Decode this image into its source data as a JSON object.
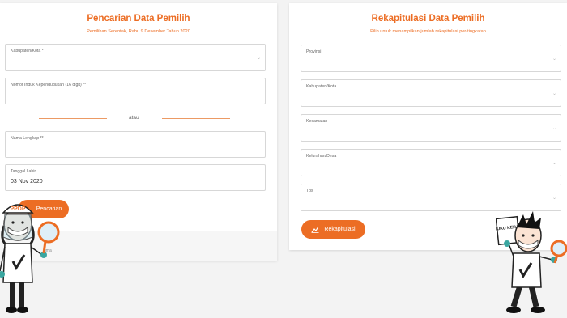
{
  "search": {
    "title": "Pencarian Data Pemilih",
    "subtitle": "Pemilihan Serentak, Rabu 9 Desember Tahun 2020",
    "fields": [
      {
        "label": "Kabupaten/Kota *",
        "value": ""
      },
      {
        "label": "Nomor Induk Kependudukan (16 digit) **",
        "value": ""
      },
      {
        "label": "Nama Lengkap **",
        "value": ""
      },
      {
        "label": "Tanggal Lahir",
        "value": "03 Nov 2020"
      }
    ],
    "or_text": "atau",
    "button": "Pencarian",
    "footer_text": "uma"
  },
  "recap": {
    "title": "Rekapitulasi Data Pemilih",
    "subtitle": "Pilih untuk menampilkan jumlah rekapitulasi per-tingkatan",
    "fields": [
      {
        "label": "Provinsi"
      },
      {
        "label": "Kabupaten/Kota"
      },
      {
        "label": "Kecamatan"
      },
      {
        "label": "Kelurahan/Desa"
      },
      {
        "label": "Tps"
      }
    ],
    "button": "Rekapitulasi"
  },
  "mascots": {
    "left_cap": "PPDP",
    "right_card": "BUKU KERJA"
  },
  "colors": {
    "accent": "#ec6d24",
    "card": "#ffffff",
    "background": "#f3f3f3"
  }
}
